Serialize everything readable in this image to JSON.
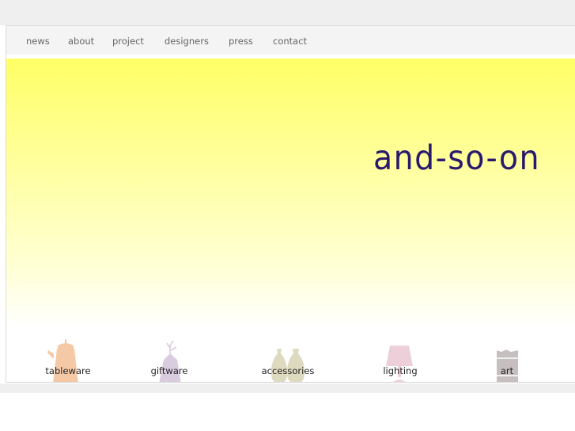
{
  "nav": {
    "items": [
      {
        "label": "news"
      },
      {
        "label": "about"
      },
      {
        "label": "project"
      },
      {
        "label": "designers"
      },
      {
        "label": "press"
      },
      {
        "label": "contact"
      }
    ]
  },
  "hero": {
    "logo_text": "and-so-on",
    "colors": {
      "gradient_top": "#ffff66",
      "gradient_bottom": "#ffffff",
      "logo": "#2a1a6e"
    }
  },
  "categories": [
    {
      "label": "tableware",
      "icon": "teapot-icon",
      "color": "#f6c9a6"
    },
    {
      "label": "giftware",
      "icon": "branch-vase-icon",
      "color": "#d9ccdf"
    },
    {
      "label": "accessories",
      "icon": "vases-icon",
      "color": "#dedac0"
    },
    {
      "label": "lighting",
      "icon": "lamp-icon",
      "color": "#eccfd9"
    },
    {
      "label": "art",
      "icon": "artwork-icon",
      "color": "#c7bfbf"
    }
  ]
}
